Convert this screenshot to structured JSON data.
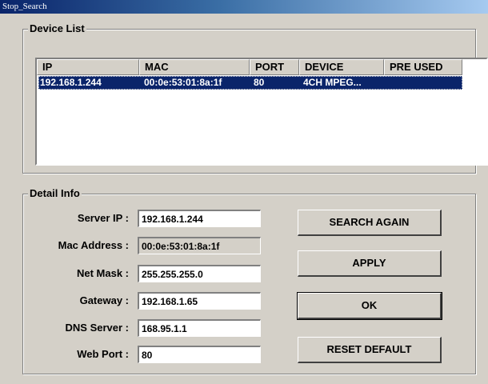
{
  "window": {
    "title": "Stop_Search"
  },
  "device_list": {
    "label": "Device List",
    "columns": [
      "IP",
      "MAC",
      "PORT",
      "DEVICE",
      "PRE USED"
    ],
    "rows": [
      {
        "ip": "192.168.1.244",
        "mac": "00:0e:53:01:8a:1f",
        "port": "80",
        "device": "4CH MPEG...",
        "pre_used": ""
      }
    ]
  },
  "detail_info": {
    "label": "Detail Info",
    "server_ip": {
      "label": "Server IP :",
      "value": "192.168.1.244"
    },
    "mac_address": {
      "label": "Mac Address :",
      "value": "00:0e:53:01:8a:1f"
    },
    "net_mask": {
      "label": "Net Mask :",
      "value": "255.255.255.0"
    },
    "gateway": {
      "label": "Gateway :",
      "value": "192.168.1.65"
    },
    "dns_server": {
      "label": "DNS Server :",
      "value": "168.95.1.1"
    },
    "web_port": {
      "label": "Web Port :",
      "value": "80"
    }
  },
  "buttons": {
    "search_again": "SEARCH AGAIN",
    "apply": "APPLY",
    "ok": "OK",
    "reset_default": "RESET DEFAULT"
  },
  "colors": {
    "selection": "#0a246a",
    "face": "#d4d0c8",
    "title_start": "#0a246a",
    "title_end": "#a6caf0"
  }
}
